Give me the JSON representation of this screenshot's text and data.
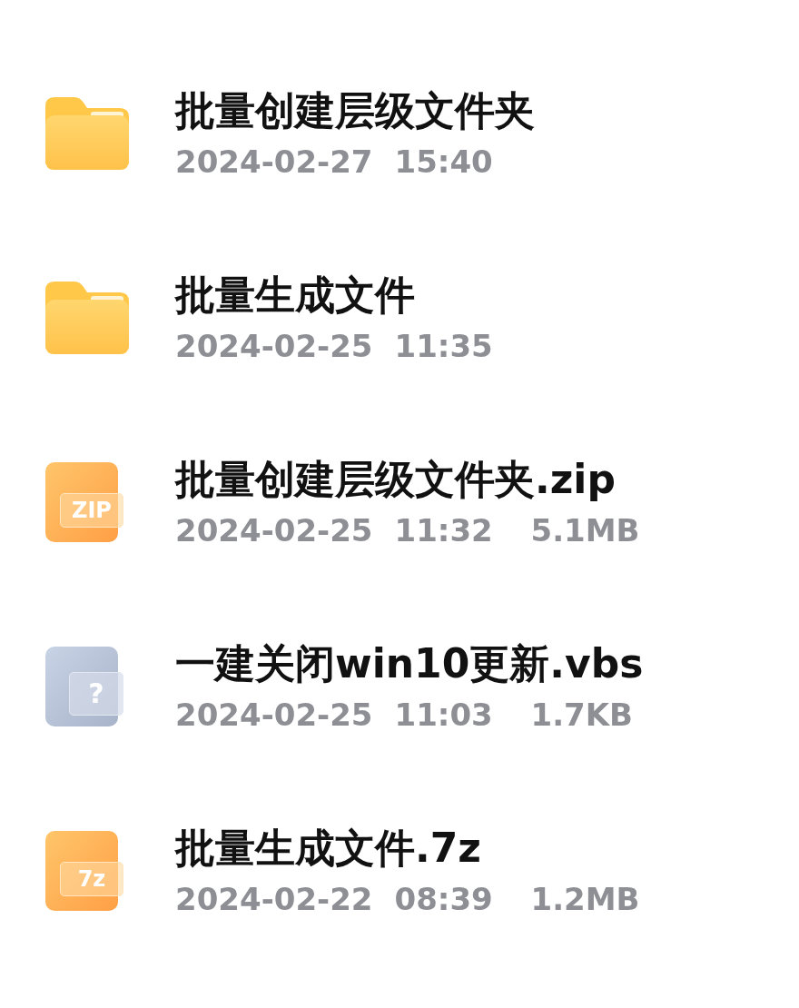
{
  "files": [
    {
      "kind": "folder",
      "name": "批量创建层级文件夹",
      "date": "2024-02-27",
      "time": "15:40"
    },
    {
      "kind": "folder",
      "name": "批量生成文件",
      "date": "2024-02-25",
      "time": "11:35"
    },
    {
      "kind": "archive",
      "badge": "ZIP",
      "name": "批量创建层级文件夹.zip",
      "date": "2024-02-25",
      "time": "11:32",
      "size": "5.1MB"
    },
    {
      "kind": "unknown",
      "badge": "?",
      "name": "一建关闭win10更新.vbs",
      "date": "2024-02-25",
      "time": "11:03",
      "size": "1.7KB"
    },
    {
      "kind": "archive",
      "badge": "7z",
      "name": "批量生成文件.7z",
      "date": "2024-02-22",
      "time": "08:39",
      "size": "1.2MB"
    }
  ]
}
